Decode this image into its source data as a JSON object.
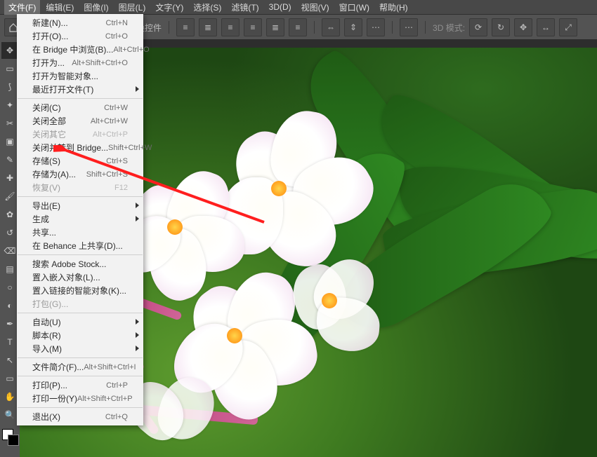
{
  "menubar": {
    "items": [
      "文件(F)",
      "编辑(E)",
      "图像(I)",
      "图层(L)",
      "文字(Y)",
      "选择(S)",
      "滤镜(T)",
      "3D(D)",
      "视图(V)",
      "窗口(W)",
      "帮助(H)"
    ],
    "open_index": 0
  },
  "options_bar": {
    "checkbox_label": "显示变换控件",
    "mode_label": "3D 模式:"
  },
  "tools": [
    {
      "name": "move-tool",
      "glyph": "✥",
      "selected": true
    },
    {
      "name": "marquee-tool",
      "glyph": "▭"
    },
    {
      "name": "lasso-tool",
      "glyph": "⟆"
    },
    {
      "name": "magic-wand-tool",
      "glyph": "✦"
    },
    {
      "name": "crop-tool",
      "glyph": "✂"
    },
    {
      "name": "frame-tool",
      "glyph": "▣"
    },
    {
      "name": "eyedropper-tool",
      "glyph": "✎"
    },
    {
      "name": "healing-brush-tool",
      "glyph": "✚"
    },
    {
      "name": "brush-tool",
      "glyph": "🖌"
    },
    {
      "name": "stamp-tool",
      "glyph": "✿"
    },
    {
      "name": "history-brush-tool",
      "glyph": "↺"
    },
    {
      "name": "eraser-tool",
      "glyph": "⌫"
    },
    {
      "name": "gradient-tool",
      "glyph": "▤"
    },
    {
      "name": "blur-tool",
      "glyph": "○"
    },
    {
      "name": "dodge-tool",
      "glyph": "◐"
    },
    {
      "name": "pen-tool",
      "glyph": "✒"
    },
    {
      "name": "type-tool",
      "glyph": "T"
    },
    {
      "name": "path-select-tool",
      "glyph": "↖"
    },
    {
      "name": "shape-tool",
      "glyph": "▭"
    },
    {
      "name": "hand-tool",
      "glyph": "✋"
    },
    {
      "name": "zoom-tool",
      "glyph": "🔍"
    }
  ],
  "menu": [
    {
      "label": "新建(N)...",
      "shortcut": "Ctrl+N"
    },
    {
      "label": "打开(O)...",
      "shortcut": "Ctrl+O"
    },
    {
      "label": "在 Bridge 中浏览(B)...",
      "shortcut": "Alt+Ctrl+O"
    },
    {
      "label": "打开为...",
      "shortcut": "Alt+Shift+Ctrl+O"
    },
    {
      "label": "打开为智能对象..."
    },
    {
      "label": "最近打开文件(T)",
      "submenu": true
    },
    {
      "sep": true
    },
    {
      "label": "关闭(C)",
      "shortcut": "Ctrl+W"
    },
    {
      "label": "关闭全部",
      "shortcut": "Alt+Ctrl+W"
    },
    {
      "label": "关闭其它",
      "shortcut": "Alt+Ctrl+P",
      "disabled": true
    },
    {
      "label": "关闭并转到 Bridge...",
      "shortcut": "Shift+Ctrl+W"
    },
    {
      "label": "存储(S)",
      "shortcut": "Ctrl+S"
    },
    {
      "label": "存储为(A)...",
      "shortcut": "Shift+Ctrl+S"
    },
    {
      "label": "恢复(V)",
      "shortcut": "F12",
      "disabled": true
    },
    {
      "sep": true
    },
    {
      "label": "导出(E)",
      "submenu": true
    },
    {
      "label": "生成",
      "submenu": true
    },
    {
      "label": "共享..."
    },
    {
      "label": "在 Behance 上共享(D)..."
    },
    {
      "sep": true
    },
    {
      "label": "搜索 Adobe Stock..."
    },
    {
      "label": "置入嵌入对象(L)..."
    },
    {
      "label": "置入链接的智能对象(K)..."
    },
    {
      "label": "打包(G)...",
      "disabled": true
    },
    {
      "sep": true
    },
    {
      "label": "自动(U)",
      "submenu": true
    },
    {
      "label": "脚本(R)",
      "submenu": true
    },
    {
      "label": "导入(M)",
      "submenu": true
    },
    {
      "sep": true
    },
    {
      "label": "文件简介(F)...",
      "shortcut": "Alt+Shift+Ctrl+I"
    },
    {
      "sep": true
    },
    {
      "label": "打印(P)...",
      "shortcut": "Ctrl+P"
    },
    {
      "label": "打印一份(Y)",
      "shortcut": "Alt+Shift+Ctrl+P"
    },
    {
      "sep": true
    },
    {
      "label": "退出(X)",
      "shortcut": "Ctrl+Q"
    }
  ]
}
